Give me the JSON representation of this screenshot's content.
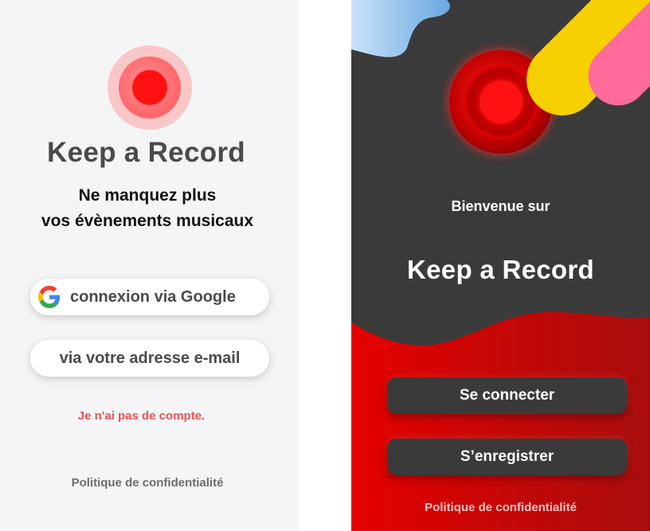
{
  "left": {
    "app_title": "Keep a Record",
    "tagline_line1": "Ne manquez plus",
    "tagline_line2": "vos évènements musicaux",
    "google_button": "connexion via Google",
    "email_button": "via votre adresse e-mail",
    "no_account_link": "Je n'ai pas de compte.",
    "privacy_link": "Politique de confidentialité"
  },
  "right": {
    "welcome": "Bienvenue sur",
    "app_title": "Keep a Record",
    "login_button": "Se connecter",
    "register_button": "S’enregistrer",
    "privacy_link": "Politique de confidentialité"
  },
  "colors": {
    "accent_red": "#ff1111",
    "dark_bg": "#3a3a3a",
    "link_red": "#f25150",
    "yellow": "#f6cf00",
    "pink": "#ff6b9a",
    "blue": "#8cc1ee"
  },
  "icons": {
    "google": "google-g-icon",
    "logo": "record-logo-icon"
  }
}
